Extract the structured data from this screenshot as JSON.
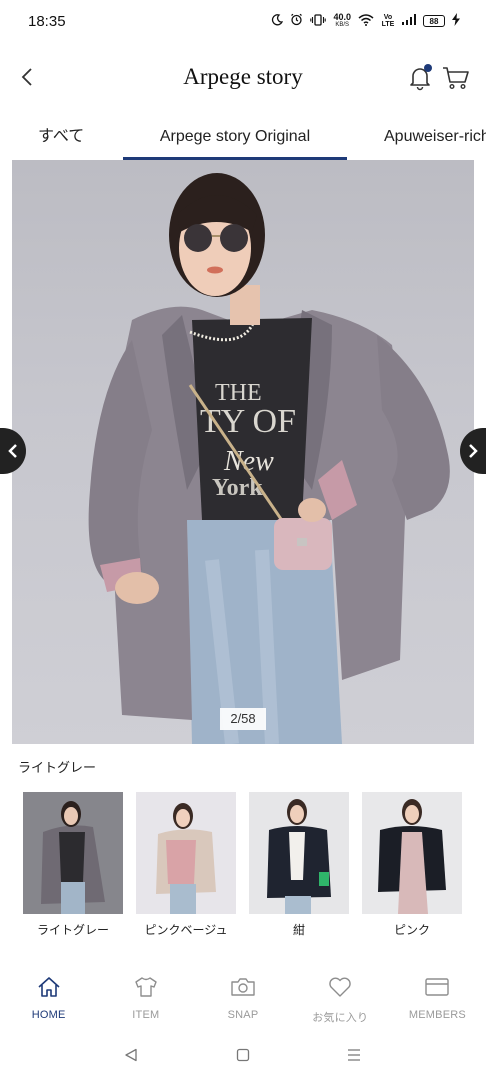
{
  "status_bar": {
    "time": "18:35",
    "speed_value": "40.0",
    "speed_unit": "KB/S",
    "network": "Vo LTE",
    "battery": "88",
    "icons": [
      "moon-icon",
      "alarm-icon",
      "vibrate-icon",
      "wifi-icon",
      "signal-icon",
      "charging-icon"
    ]
  },
  "header": {
    "title": "Arpege story",
    "icons": [
      "back-arrow-icon",
      "bell-icon",
      "cart-icon"
    ],
    "notification_dot_color": "#1e3a78"
  },
  "tabs": [
    {
      "label": "すべて",
      "active": false
    },
    {
      "label": "Arpege story Original",
      "active": true
    },
    {
      "label": "Apuweiser-rich",
      "active": false
    }
  ],
  "gallery": {
    "counter": "2/58",
    "icons": [
      "chevron-left-icon",
      "chevron-right-icon"
    ]
  },
  "selected_color": "ライトグレー",
  "variants": [
    {
      "label": "ライトグレー",
      "selected": true
    },
    {
      "label": "ピンクベージュ",
      "selected": false
    },
    {
      "label": "紺",
      "selected": false
    },
    {
      "label": "ピンク",
      "selected": false
    }
  ],
  "bottom_nav": [
    {
      "label": "HOME",
      "icon": "home-icon",
      "active": true
    },
    {
      "label": "ITEM",
      "icon": "tshirt-icon",
      "active": false
    },
    {
      "label": "SNAP",
      "icon": "camera-icon",
      "active": false
    },
    {
      "label": "お気に入り",
      "icon": "heart-icon",
      "active": false
    },
    {
      "label": "MEMBERS",
      "icon": "card-icon",
      "active": false
    }
  ],
  "system_nav": [
    "back-triangle-icon",
    "home-square-icon",
    "menu-lines-icon"
  ],
  "colors": {
    "accent": "#1e3a78",
    "inactive": "#9a9a9a"
  }
}
